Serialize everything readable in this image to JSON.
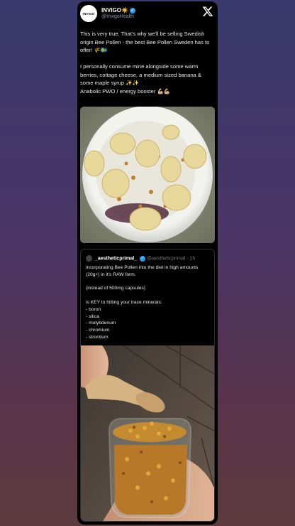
{
  "author": {
    "avatar_text": "INVIGO",
    "name": "INVIGO☀️",
    "handle": "@InvigoHealth"
  },
  "tweet": {
    "text": "This is very true. That's why we'll be selling Swedish origin Bee Pollen - the best Bee Pollen Sweden has to offer! 🌾🇸🇪\n\nI personally consume mine alongside some warm berries, cottage cheese, a medium sized banana & some maple syrup ✨✨\nAnabolic PWO / energy booster 💪🏼💪🏼"
  },
  "quoted": {
    "name": "_aestheticprimal_",
    "handle": "@aestheticprimal",
    "time": "· 1h",
    "text": "incorporating Bee Pollen into the diet in high amounts (20g+) in it's RAW form.\n\n(instead of 500mg capsules)\n\nis KEY to hitting your trace minerals:\n- boron\n- silica\n- molybdenum\n- chromium\n- strontium"
  },
  "icons": {
    "x_logo": "x-logo-icon",
    "verified": "verified-badge-icon"
  },
  "colors": {
    "background": "#000000",
    "text": "#e7e9ea",
    "muted": "#8b98a5",
    "verified": "#1d9bf0"
  }
}
